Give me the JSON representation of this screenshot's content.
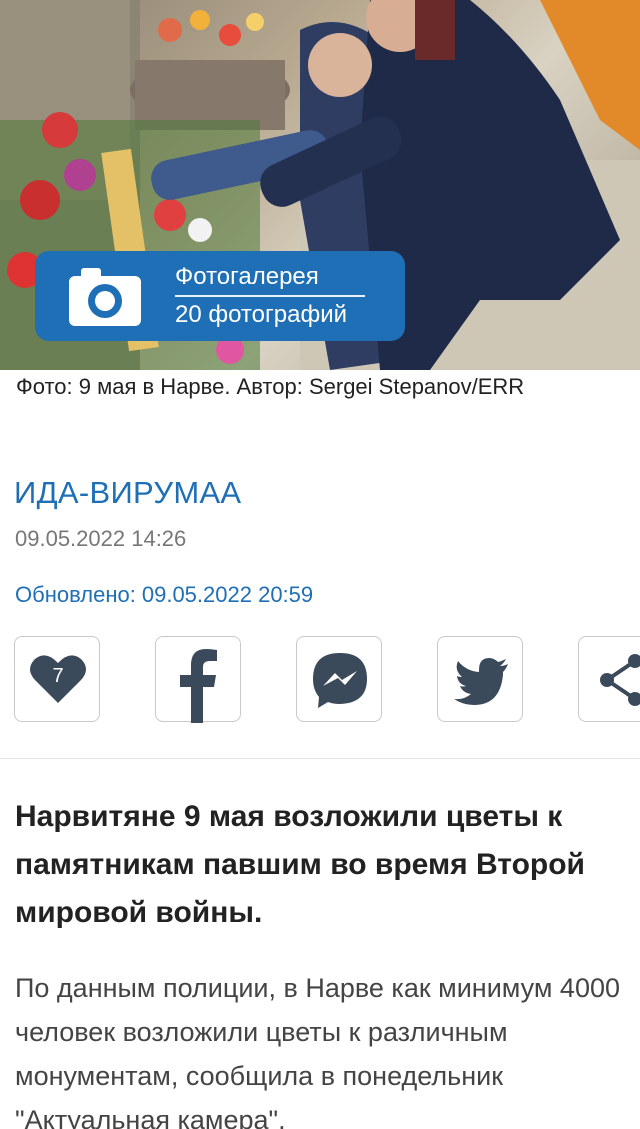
{
  "hero": {
    "photo_alt": "Фото",
    "gallery": {
      "title": "Фотогалерея",
      "count_label": "20 фотографий",
      "icon": "camera-icon"
    }
  },
  "caption": "Фото: 9 мая в Нарве. Автор: Sergei Stepanov/ERR",
  "article": {
    "category": "ИДА-ВИРУМАА",
    "published": "09.05.2022 14:26",
    "updated_label": "Обновлено:",
    "updated_value": "09.05.2022 20:59",
    "headline": "Нарвитяне 9 мая возложили цветы к памятникам павшим во время Второй мировой войны.",
    "lead": "По данным полиции, в Нарве как минимум 4000 человек возложили цветы к различным монументам, сообщила в понедельник \"Актуальная камера\"."
  },
  "share": {
    "like_count": "7",
    "buttons": [
      {
        "name": "like",
        "icon": "heart-icon"
      },
      {
        "name": "facebook",
        "icon": "facebook-icon"
      },
      {
        "name": "messenger",
        "icon": "messenger-icon"
      },
      {
        "name": "twitter",
        "icon": "twitter-icon"
      },
      {
        "name": "share",
        "icon": "share-icon"
      }
    ]
  },
  "colors": {
    "accent": "#1f6fb6",
    "icon": "#3a4a5a",
    "muted": "#777777"
  }
}
